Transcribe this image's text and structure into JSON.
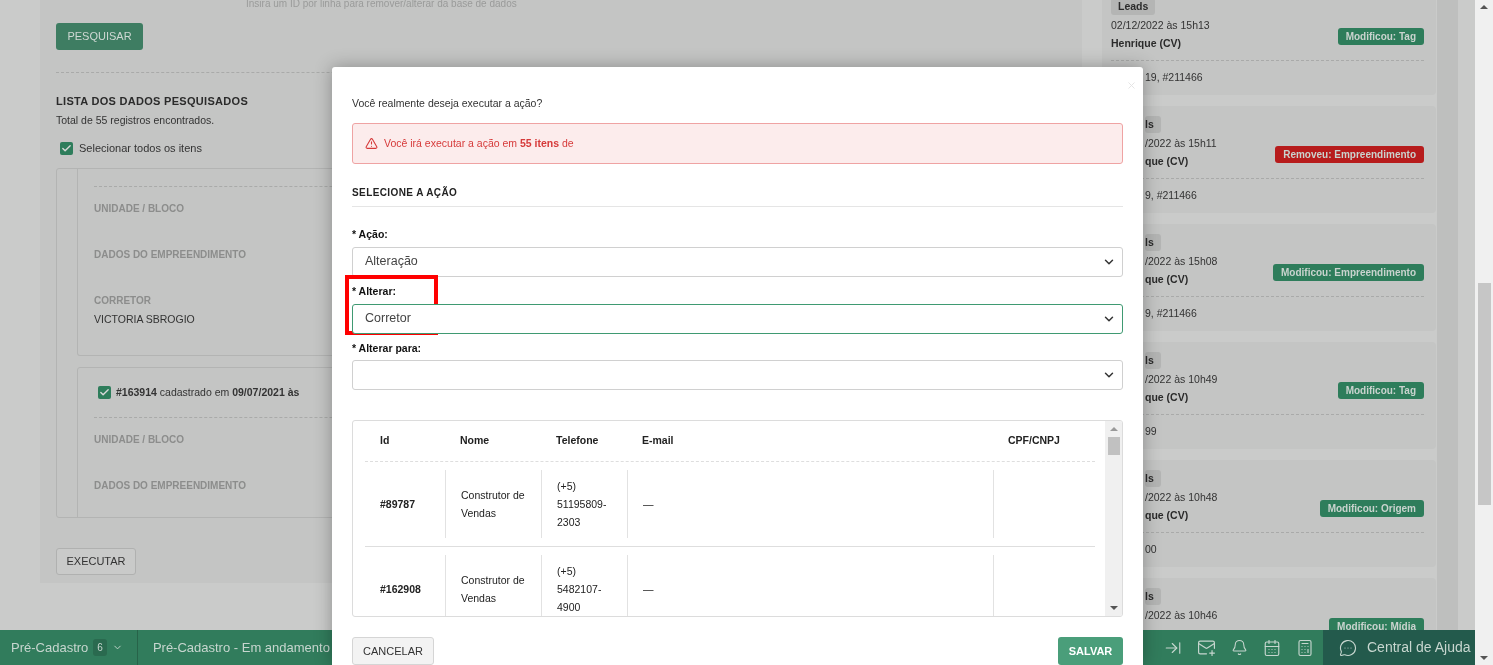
{
  "page": {
    "hint": "Insira um ID por linha para remover/alterar da base de dados",
    "search_button": "PESQUISAR",
    "list_title": "LISTA DOS DADOS PESQUISADOS",
    "total": "Total de 55 registros encontrados.",
    "select_all": {
      "label": "Selecionar todos os itens",
      "checked": true
    },
    "records": [
      {
        "fields": [
          {
            "label": "UNIDADE / BLOCO"
          },
          {
            "label": "DADOS DO EMPREENDIMENTO"
          },
          {
            "label": "CORRETOR",
            "value": "VICTORIA SBROGIO"
          }
        ]
      },
      {
        "checked": true,
        "header": "**#163914** cadastrado em **09/07/2021 às**",
        "fields": [
          {
            "label": "UNIDADE / BLOCO"
          },
          {
            "label": "DADOS DO EMPREENDIMENTO"
          }
        ]
      }
    ],
    "execute_button": "EXECUTAR"
  },
  "activity": [
    {
      "covered": false,
      "tag": "Leads",
      "date": "02/12/2022 às 15h13",
      "user": "Henrique (CV)",
      "badge": {
        "label": "Modificou: Tag",
        "color": "#2e7d5b"
      },
      "ids": "19, #211466"
    },
    {
      "covered": true,
      "tag": "ls",
      "date": "/2022 às 15h11",
      "user": "que (CV)",
      "badge": {
        "label": "Removeu: Empreendimento",
        "color": "#b71c1c"
      },
      "ids": "9, #211466"
    },
    {
      "covered": true,
      "tag": "ls",
      "date": "/2022 às 15h08",
      "user": "que (CV)",
      "badge": {
        "label": "Modificou: Empreendimento",
        "color": "#2e7d5b"
      },
      "ids": "9, #211466"
    },
    {
      "covered": true,
      "tag": "ls",
      "date": "/2022 às 10h49",
      "user": "que (CV)",
      "badge": {
        "label": "Modificou: Tag",
        "color": "#2e7d5b"
      },
      "ids": "99"
    },
    {
      "covered": true,
      "tag": "ls",
      "date": "/2022 às 10h48",
      "user": "que (CV)",
      "badge": {
        "label": "Modificou: Origem",
        "color": "#2e7d5b"
      },
      "ids": "00"
    },
    {
      "covered": true,
      "tag": "ls",
      "date": "/2022 às 10h46",
      "badge": {
        "label": "Modificou: Mídia",
        "color": "#2e7d5b"
      }
    }
  ],
  "bottom_bar": {
    "tabs": [
      {
        "label": "Pré-Cadastro",
        "count": "6"
      },
      {
        "label": "Pré-Cadastro - Em andamento"
      }
    ],
    "help": "Central de Ajuda"
  },
  "modal": {
    "question": "Você realmente deseja executar a ação?",
    "alert": "Você irá executar a ação em **55 itens** de",
    "section": "SELECIONE A AÇÃO",
    "fields": [
      {
        "label": "* Ação:",
        "value": "Alteração",
        "focused": false,
        "highlighted": false
      },
      {
        "label": "* Alterar:",
        "value": "Corretor",
        "focused": true,
        "highlighted": true
      },
      {
        "label": "* Alterar para:",
        "focused": false,
        "highlighted": false
      }
    ],
    "table": {
      "columns": [
        "Id",
        "Nome",
        "Telefone",
        "E-mail",
        "CPF/CNPJ"
      ],
      "rows": [
        {
          "cells": [
            "#89787",
            "Construtor de Vendas",
            "(+5) 51195809-2303",
            "—"
          ]
        },
        {
          "cells": [
            "#162908",
            "Construtor de Vendas",
            "(+5) 5482107-4900",
            "—"
          ]
        }
      ]
    },
    "cancel_button": "CANCELAR",
    "save_button": "SALVAR"
  }
}
